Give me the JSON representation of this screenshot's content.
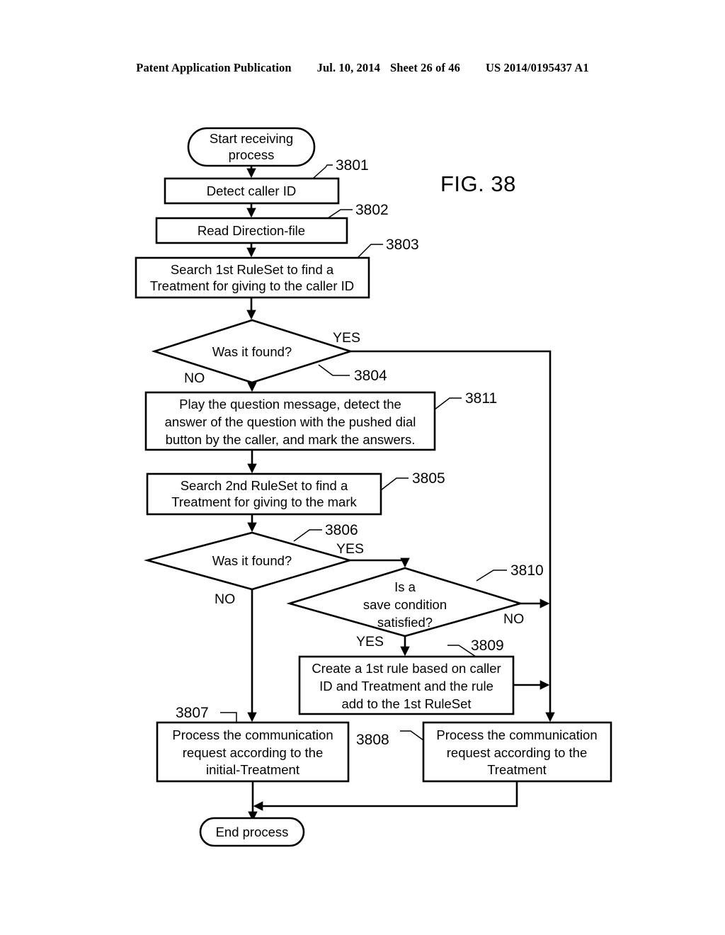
{
  "header": {
    "publication": "Patent Application Publication",
    "date": "Jul. 10, 2014",
    "sheet": "Sheet 26 of 46",
    "patent_number": "US 2014/0195437 A1"
  },
  "figure": {
    "label": "FIG. 38"
  },
  "chart_data": {
    "type": "diagram",
    "title": "FIG. 38",
    "diagram_kind": "flowchart",
    "nodes": [
      {
        "id": "start",
        "ref": "",
        "shape": "terminator",
        "text": "Start receiving process"
      },
      {
        "id": "3801",
        "ref": "3801",
        "shape": "process",
        "text": "Detect caller ID"
      },
      {
        "id": "3802",
        "ref": "3802",
        "shape": "process",
        "text": "Read Direction-file"
      },
      {
        "id": "3803",
        "ref": "3803",
        "shape": "process",
        "text": "Search 1st RuleSet to find a Treatment for giving to the caller ID"
      },
      {
        "id": "3804",
        "ref": "3804",
        "shape": "decision",
        "text": "Was it found?"
      },
      {
        "id": "3811",
        "ref": "3811",
        "shape": "process",
        "text": "Play the question message, detect the answer of the question with the pushed dial button by the caller, and mark the answers."
      },
      {
        "id": "3805",
        "ref": "3805",
        "shape": "process",
        "text": "Search 2nd RuleSet to find a Treatment for giving to the mark"
      },
      {
        "id": "3806",
        "ref": "3806",
        "shape": "decision",
        "text": "Was it found?"
      },
      {
        "id": "3810",
        "ref": "3810",
        "shape": "decision",
        "text": "Is a save condition satisfied?"
      },
      {
        "id": "3809",
        "ref": "3809",
        "shape": "process",
        "text": "Create a 1st rule based on caller ID and Treatment and the rule add to the 1st RuleSet"
      },
      {
        "id": "3807",
        "ref": "3807",
        "shape": "process",
        "text": "Process the communication request according to the initial-Treatment"
      },
      {
        "id": "3808",
        "ref": "3808",
        "shape": "process",
        "text": "Process the communication request according to the Treatment"
      },
      {
        "id": "end",
        "ref": "",
        "shape": "terminator",
        "text": "End process"
      }
    ],
    "edges": [
      {
        "from": "start",
        "to": "3801",
        "label": ""
      },
      {
        "from": "3801",
        "to": "3802",
        "label": ""
      },
      {
        "from": "3802",
        "to": "3803",
        "label": ""
      },
      {
        "from": "3803",
        "to": "3804",
        "label": ""
      },
      {
        "from": "3804",
        "to": "3808",
        "label": "YES"
      },
      {
        "from": "3804",
        "to": "3811",
        "label": "NO"
      },
      {
        "from": "3811",
        "to": "3805",
        "label": ""
      },
      {
        "from": "3805",
        "to": "3806",
        "label": ""
      },
      {
        "from": "3806",
        "to": "3810",
        "label": "YES"
      },
      {
        "from": "3806",
        "to": "3807",
        "label": "NO"
      },
      {
        "from": "3810",
        "to": "3809",
        "label": "YES"
      },
      {
        "from": "3810",
        "to": "3808",
        "label": "NO"
      },
      {
        "from": "3809",
        "to": "3808",
        "label": ""
      },
      {
        "from": "3807",
        "to": "end",
        "label": ""
      },
      {
        "from": "3808",
        "to": "end",
        "label": ""
      }
    ]
  },
  "nodes": {
    "start": {
      "line1": "Start receiving",
      "line2": "process"
    },
    "n3801": {
      "line1": "Detect caller ID"
    },
    "n3802": {
      "line1": "Read Direction-file"
    },
    "n3803": {
      "line1": "Search 1st RuleSet to find a",
      "line2": "Treatment for giving to the caller ID"
    },
    "n3804": {
      "line1": "Was it found?"
    },
    "n3811": {
      "line1": "Play the question message, detect the",
      "line2": "answer of the question with the pushed dial",
      "line3": "button by the caller, and mark the answers."
    },
    "n3805": {
      "line1": "Search 2nd RuleSet to find a",
      "line2": "Treatment for giving to the mark"
    },
    "n3806": {
      "line1": "Was it found?"
    },
    "n3810": {
      "line1": "Is a",
      "line2": "save condition",
      "line3": "satisfied?"
    },
    "n3809": {
      "line1": "Create a 1st rule based on caller",
      "line2": "ID and Treatment and the rule",
      "line3": "add to the 1st RuleSet"
    },
    "n3807": {
      "line1": "Process the communication",
      "line2": "request according to the",
      "line3": "initial-Treatment"
    },
    "n3808": {
      "line1": "Process the communication",
      "line2": "request according to the",
      "line3": "Treatment"
    },
    "end": {
      "line1": "End process"
    }
  },
  "refs": {
    "r3801": "3801",
    "r3802": "3802",
    "r3803": "3803",
    "r3804": "3804",
    "r3805": "3805",
    "r3806": "3806",
    "r3807": "3807",
    "r3808": "3808",
    "r3809": "3809",
    "r3810": "3810",
    "r3811": "3811"
  },
  "branches": {
    "yes_3804": "YES",
    "no_3804": "NO",
    "yes_3806": "YES",
    "no_3806": "NO",
    "yes_3810": "YES",
    "no_3810": "NO"
  },
  "colors": {
    "ink": "#000000",
    "paper": "#ffffff"
  }
}
